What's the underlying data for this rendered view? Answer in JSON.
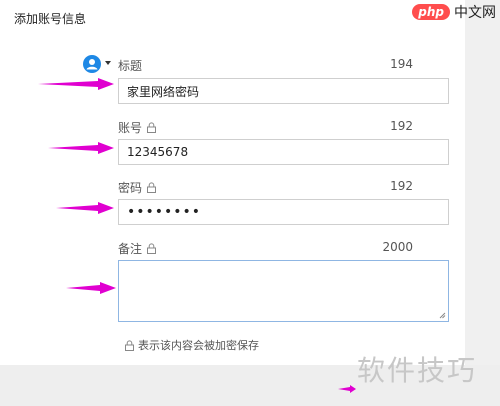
{
  "dialog": {
    "title": "添加账号信息"
  },
  "fields": {
    "title": {
      "label": "标题",
      "count": "194",
      "value": "家里网络密码"
    },
    "account": {
      "label": "账号",
      "count": "192",
      "value": "12345678"
    },
    "password": {
      "label": "密码",
      "count": "192",
      "value": "••••••••"
    },
    "note": {
      "label": "备注",
      "count": "2000",
      "value": ""
    }
  },
  "footer": {
    "note": "表示该内容会被加密保存"
  },
  "branding": {
    "php_badge": "php",
    "site_name": "中文网",
    "watermark": "软件技巧"
  },
  "colors": {
    "accent_blue": "#1e88e5",
    "arrow_magenta": "#e000d0"
  },
  "icons": [
    "avatar-icon",
    "chevron-down-icon",
    "lock-icon",
    "resize-grip-icon"
  ]
}
